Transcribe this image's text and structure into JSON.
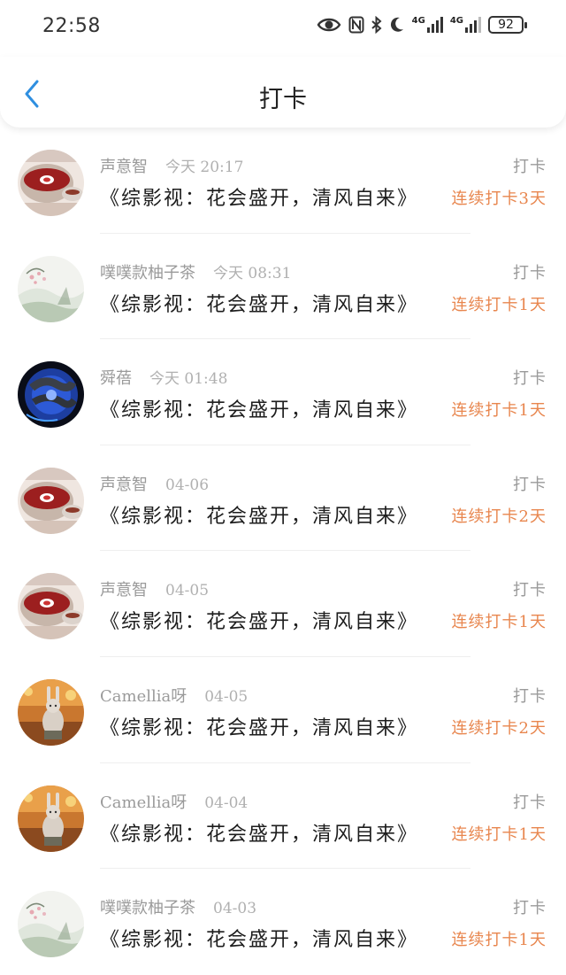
{
  "status_bar": {
    "time": "22:58",
    "network_1": "4G",
    "network_2": "4G",
    "battery": "92"
  },
  "header": {
    "title": "打卡",
    "back_icon": "chevron-left-icon",
    "accent_color": "#2f8fe0"
  },
  "colors": {
    "streak": "#e8864e",
    "muted": "#9a9a9a"
  },
  "items": [
    {
      "user": "声意智",
      "time": "今天 20:17",
      "book": "《综影视：花会盛开，清风自来》",
      "action": "打卡",
      "streak": "连续打卡3天",
      "avatar": "tea-cup-avatar"
    },
    {
      "user": "噗噗款柚子茶",
      "time": "今天 08:31",
      "book": "《综影视：花会盛开，清风自来》",
      "action": "打卡",
      "streak": "连续打卡1天",
      "avatar": "ink-painting-avatar"
    },
    {
      "user": "舜蓓",
      "time": "今天 01:48",
      "book": "《综影视：花会盛开，清风自来》",
      "action": "打卡",
      "streak": "连续打卡1天",
      "avatar": "blue-rose-avatar"
    },
    {
      "user": "声意智",
      "time": "04-06",
      "book": "《综影视：花会盛开，清风自来》",
      "action": "打卡",
      "streak": "连续打卡2天",
      "avatar": "tea-cup-avatar"
    },
    {
      "user": "声意智",
      "time": "04-05",
      "book": "《综影视：花会盛开，清风自来》",
      "action": "打卡",
      "streak": "连续打卡1天",
      "avatar": "tea-cup-avatar"
    },
    {
      "user": "Camellia呀",
      "time": "04-05",
      "book": "《综影视：花会盛开，清风自来》",
      "action": "打卡",
      "streak": "连续打卡2天",
      "avatar": "bunny-avatar"
    },
    {
      "user": "Camellia呀",
      "time": "04-04",
      "book": "《综影视：花会盛开，清风自来》",
      "action": "打卡",
      "streak": "连续打卡1天",
      "avatar": "bunny-avatar"
    },
    {
      "user": "噗噗款柚子茶",
      "time": "04-03",
      "book": "《综影视：花会盛开，清风自来》",
      "action": "打卡",
      "streak": "连续打卡1天",
      "avatar": "ink-painting-avatar"
    }
  ]
}
